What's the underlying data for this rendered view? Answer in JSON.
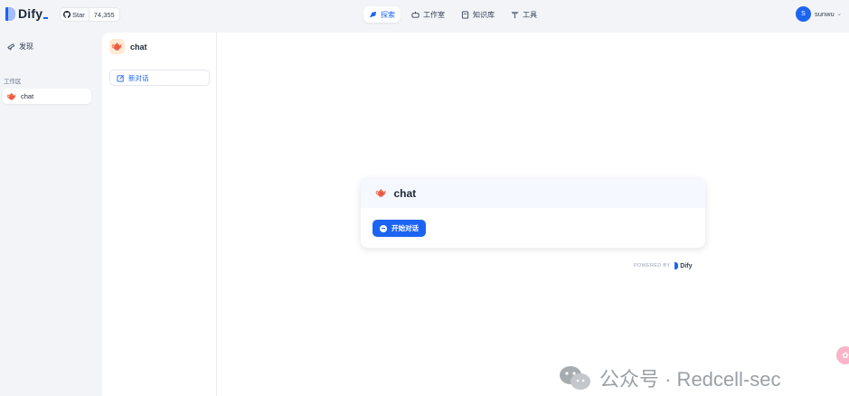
{
  "header": {
    "logo_text": "Dify",
    "github": {
      "star_label": "Star",
      "count": "74,355"
    },
    "nav": [
      {
        "label": "探索",
        "icon": "explore-icon",
        "active": true
      },
      {
        "label": "工作室",
        "icon": "robot-icon",
        "active": false
      },
      {
        "label": "知识库",
        "icon": "book-icon",
        "active": false
      },
      {
        "label": "工具",
        "icon": "tool-icon",
        "active": false
      }
    ],
    "user": {
      "initial": "S",
      "name": "sunwu"
    }
  },
  "sidebar": {
    "discover_label": "发现",
    "workspace_label": "工作区",
    "items": [
      {
        "label": "chat",
        "icon": "teapot-emoji"
      }
    ]
  },
  "conversation_panel": {
    "app_name": "chat",
    "new_chat_label": "新对话"
  },
  "welcome_card": {
    "title": "chat",
    "start_button": "开始对话"
  },
  "footer": {
    "powered_by": "POWERED BY",
    "brand": "Dify"
  },
  "watermark": {
    "text": "公众号 · Redcell-sec"
  },
  "colors": {
    "accent": "#1c64f2",
    "background": "#f2f4f7",
    "card_header": "#f5f8ff"
  }
}
